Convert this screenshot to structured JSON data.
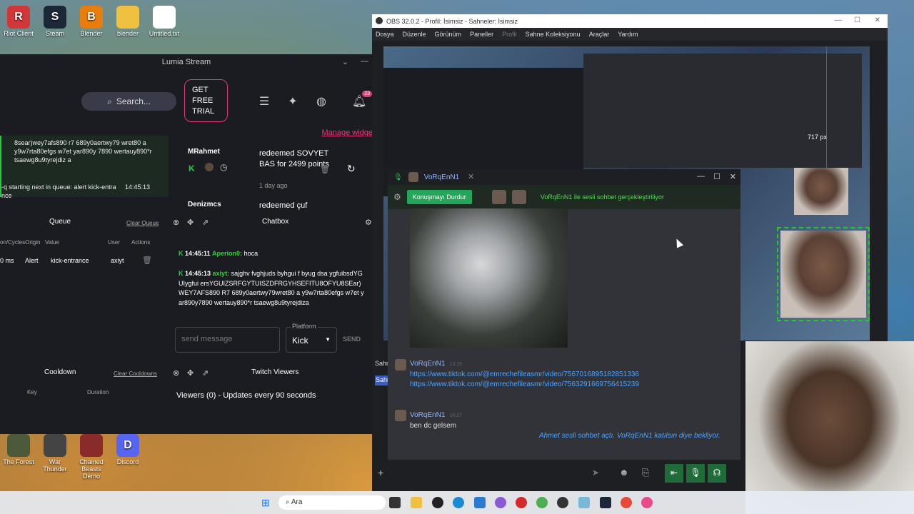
{
  "desktop": {
    "icons_top": [
      {
        "label": "Riot Client",
        "glyph": "R",
        "color": "#d13639"
      },
      {
        "label": "Steam",
        "glyph": "S",
        "color": "#1b2838"
      },
      {
        "label": "Blender",
        "glyph": "B",
        "color": "#e87d0d"
      },
      {
        "label": "blender",
        "glyph": "",
        "color": "#f0c040"
      },
      {
        "label": "Untitled.txt",
        "glyph": "",
        "color": "#ffffff"
      }
    ],
    "icons_bottom": [
      {
        "label": "The Forest",
        "glyph": "",
        "color": "#4a5a3a"
      },
      {
        "label": "War Thunder",
        "glyph": "",
        "color": "#444444"
      },
      {
        "label": "Chained Beasts Demo",
        "glyph": "",
        "color": "#8a2a2a"
      },
      {
        "label": "Discord",
        "glyph": "D",
        "color": "#5865f2"
      }
    ]
  },
  "lumia": {
    "title": "Lumia Stream",
    "search_label": "Search...",
    "trial_label": "GET FREE TRIAL",
    "notif_count": "23",
    "manage_link": "Manage widge",
    "log_text": "8sear)wey7afs890 r7 689y0aertwy79 wret80 a y9w7rta80efgs w7et yar890y 7890 wertauy890*r tsaewg8u9tyrejdiz a",
    "log_line2": "-q  starting next in queue: alert kick-entra nce",
    "log_line2_time": "14:45:13",
    "redeems": [
      {
        "user": "MRahmet",
        "action": "redeemed SOVYET BAS for 2499 points",
        "when": "1 day ago"
      },
      {
        "user": "Denizmcs",
        "action": "redeemed çuf",
        "when": ""
      }
    ],
    "queue": {
      "title": "Queue",
      "clear": "Clear Queue",
      "columns": [
        "on/CyclesOrigin",
        "Value",
        "User",
        "Actions"
      ],
      "rows": [
        {
          "time": "0 ms",
          "type": "Alert",
          "value": "kick-entrance",
          "user": "axiyt"
        }
      ]
    },
    "chatbox": {
      "title": "Chatbox",
      "messages": [
        {
          "time": "14:45:11",
          "name": "Aperion0:",
          "text": "hoca"
        },
        {
          "time": "14:45:13",
          "name": "axiyt:",
          "text": "sajghv fvghjuds byhgui f byug dsa ygfuibsdYGUIygfui ersYGUIZSRFGYTUISZDFRGYHSEFITU8OFYU8SEar)WEY7AFS890 R7 689y0aertwy79wret80 a y9w7rta80efgs w7et yar890y7890 wertauy890*r tsaewg8u9tyrejdiza"
        }
      ],
      "input_placeholder": "send message",
      "platform_label": "Platform",
      "platform_value": "Kick",
      "send_label": "SEND"
    },
    "cooldown": {
      "title": "Cooldown",
      "clear": "Clear Cooldowns",
      "columns": [
        "Key",
        "Duration"
      ]
    },
    "twitch": {
      "title": "Twitch Viewers",
      "text": "Viewers (0) - Updates every 90 seconds"
    }
  },
  "obs": {
    "title": "OBS 32.0.2 - Profil: İsimsiz - Sahneler: İsimsiz",
    "menu": [
      "Dosya",
      "Düzenle",
      "Görünüm",
      "Paneller",
      "Profil",
      "Sahne Koleksiyonu",
      "Araçlar",
      "Yardım"
    ],
    "dim_menu": "Profil",
    "side_labels": [
      "Sahn",
      "Sahi"
    ],
    "px_label": "717 px"
  },
  "discord": {
    "title": "VoRqEnN1",
    "stop_btn": "Konuşmayı Durdur",
    "status": "VoRqEnN1 ile sesli sohbet gerçekleştiriliyor",
    "msg1_name": "VoRqEnN1",
    "msg1_time": "13:15",
    "link1": "https://www.tiktok.com/@emrechefileasmr/video/7567016895182851336",
    "link2": "https://www.tiktok.com/@emrechefileasmr/video/7563291669756415239",
    "msg2_name": "VoRqEnN1",
    "msg2_time": "14:27",
    "msg2_text": "ben dc gelsem",
    "system": "Ahmet sesli sohbet açtı. VoRqEnN1 katılsın diye bekliyor."
  },
  "taskbar": {
    "search": "Ara"
  }
}
